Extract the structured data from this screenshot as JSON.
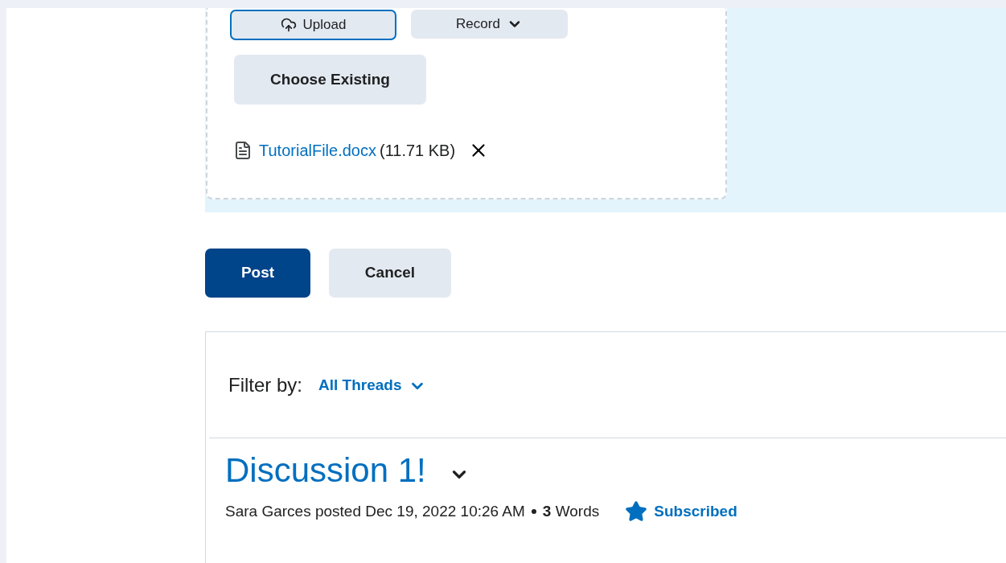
{
  "attachments": {
    "buttons": [
      {
        "label": "Upload",
        "kind": "upload",
        "focused": true
      },
      {
        "label": "Record",
        "kind": "record",
        "focused": false
      }
    ],
    "choose_existing": "Choose Existing",
    "file": {
      "name": "TutorialFile.docx",
      "size": "(11.71 KB)"
    }
  },
  "actions": {
    "post": "Post",
    "cancel": "Cancel"
  },
  "filter": {
    "label": "Filter by:",
    "value": "All Threads"
  },
  "thread": {
    "title": "Discussion 1!",
    "author_line": "Sara Garces posted Dec 19, 2022 10:26 AM",
    "word_count": "**3** Words",
    "subscribed": true,
    "subscribe_label": "Subscribed"
  }
}
